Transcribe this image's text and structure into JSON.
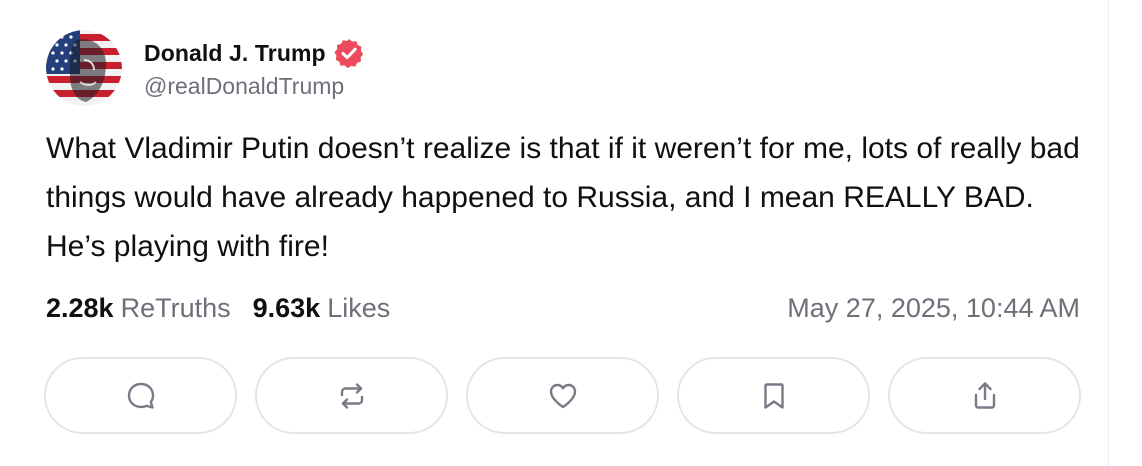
{
  "author": {
    "display_name": "Donald J. Trump",
    "handle": "@realDonaldTrump",
    "verified": true,
    "avatar_icon": "flag-portrait-avatar",
    "verified_icon": "verified-badge-icon"
  },
  "post": {
    "text": "What Vladimir Putin doesn’t realize is that if it weren’t for me, lots of really bad things would have already happened to Russia, and I mean REALLY BAD. He’s playing with fire!",
    "timestamp": "May 27, 2025, 10:44 AM"
  },
  "stats": {
    "retruths_count": "2.28k",
    "retruths_label": "ReTruths",
    "likes_count": "9.63k",
    "likes_label": "Likes"
  },
  "actions": [
    {
      "name": "reply",
      "icon": "comment-icon"
    },
    {
      "name": "retruth",
      "icon": "repost-icon"
    },
    {
      "name": "like",
      "icon": "heart-icon"
    },
    {
      "name": "bookmark",
      "icon": "bookmark-icon"
    },
    {
      "name": "share",
      "icon": "share-icon"
    }
  ],
  "colors": {
    "verified_badge": "#ec4b5e",
    "secondary_text": "#6f6f7a",
    "button_border": "#e4e4ea",
    "icon_stroke": "#7a7a86"
  }
}
